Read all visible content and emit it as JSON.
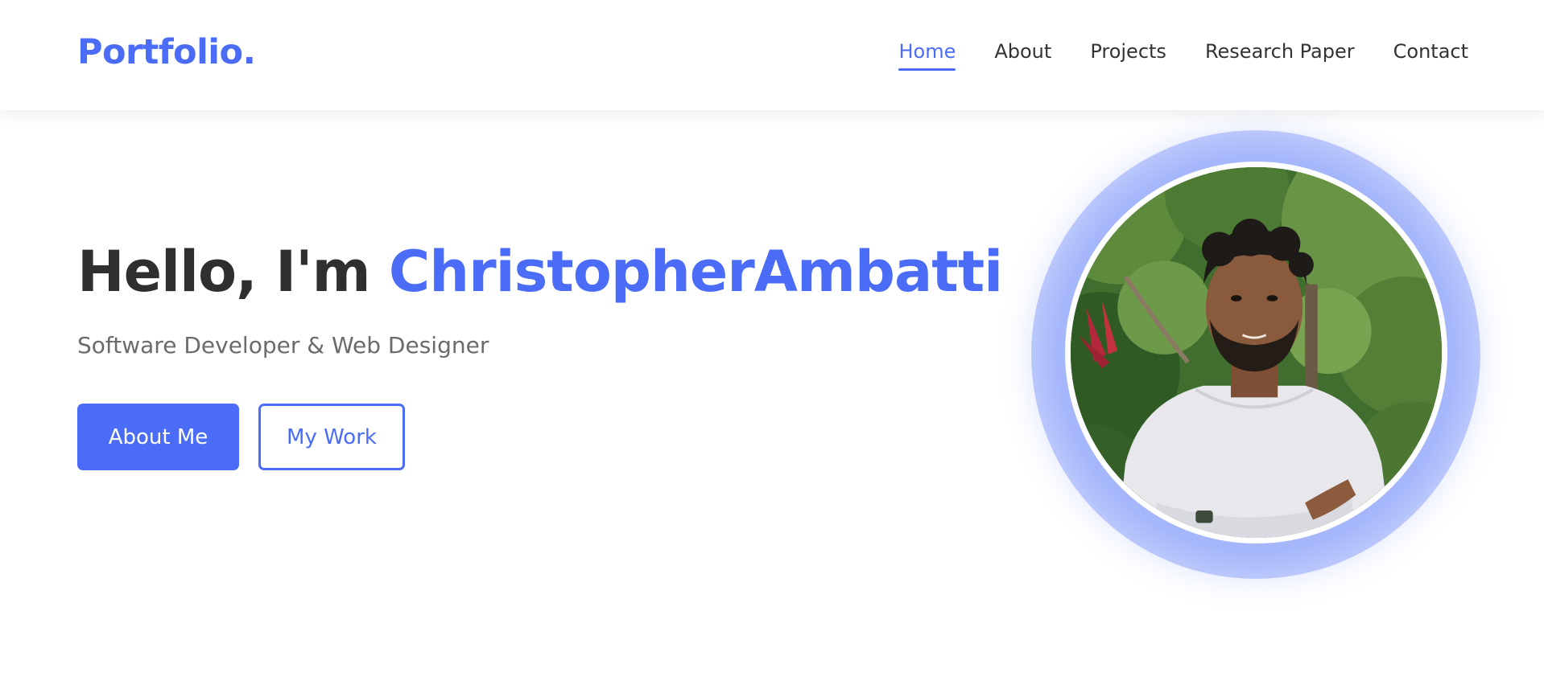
{
  "header": {
    "logo": "Portfolio.",
    "nav": [
      {
        "label": "Home",
        "active": true
      },
      {
        "label": "About",
        "active": false
      },
      {
        "label": "Projects",
        "active": false
      },
      {
        "label": "Research Paper",
        "active": false
      },
      {
        "label": "Contact",
        "active": false
      }
    ]
  },
  "hero": {
    "greeting": "Hello, I'm",
    "name": "ChristopherAmbatti",
    "subtitle": "Software Developer & Web Designer",
    "primary_button": "About Me",
    "secondary_button": "My Work"
  },
  "profile": {
    "image_description": "profile-photo"
  },
  "colors": {
    "accent": "#4a6cf7",
    "heading": "#2f2f2f",
    "subtitle": "#6b6b6b",
    "nav_text": "#333333"
  }
}
